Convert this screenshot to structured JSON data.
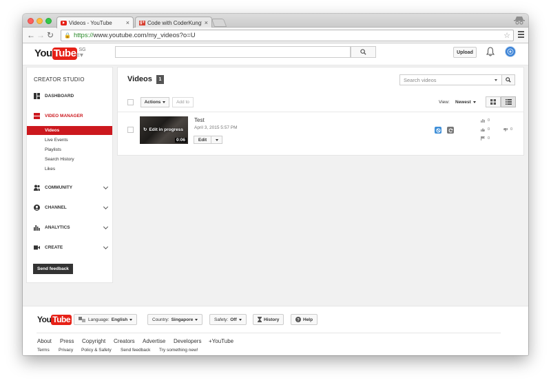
{
  "browser": {
    "tabs": [
      {
        "label": "Videos - YouTube",
        "active": true
      },
      {
        "label": "Code with CoderKungfu - ",
        "active": false
      }
    ],
    "url_scheme": "https://",
    "url_rest": "www.youtube.com/my_videos?o=U"
  },
  "header": {
    "logo_you": "You",
    "logo_tube": "Tube",
    "region": "SG",
    "upload_label": "Upload"
  },
  "sidebar": {
    "title": "CREATOR STUDIO",
    "dashboard": "DASHBOARD",
    "video_manager": "VIDEO MANAGER",
    "sub_items": [
      "Videos",
      "Live Events",
      "Playlists",
      "Search History",
      "Likes"
    ],
    "community": "COMMUNITY",
    "channel": "CHANNEL",
    "analytics": "ANALYTICS",
    "create": "CREATE",
    "feedback_label": "Send feedback"
  },
  "main": {
    "title": "Videos",
    "count": "1",
    "search_placeholder": "Search videos",
    "actions_label": "Actions",
    "add_to_label": "Add to",
    "view_label": "View:",
    "sort_label": "Newest"
  },
  "video": {
    "title": "Test",
    "date": "April 3, 2015 5:57 PM",
    "status_overlay": "Edit in progress",
    "duration": "0:06",
    "edit_label": "Edit",
    "views": "0",
    "likes": "0",
    "dislikes": "0",
    "comments": "0"
  },
  "footer": {
    "logo_you": "You",
    "logo_tube": "Tube",
    "language_label": "Language:",
    "language_value": "English",
    "country_label": "Country:",
    "country_value": "Singapore",
    "safety_label": "Safety:",
    "safety_value": "Off",
    "history_label": "History",
    "help_label": "Help",
    "links": [
      "About",
      "Press",
      "Copyright",
      "Creators",
      "Advertise",
      "Developers",
      "+YouTube"
    ],
    "links_small": [
      "Terms",
      "Privacy",
      "Policy & Safety",
      "Send feedback",
      "Try something new!"
    ]
  },
  "colors": {
    "brand_red": "#e62117",
    "sidebar_active": "#cc181e",
    "privacy_blue": "#3f8fd8"
  }
}
